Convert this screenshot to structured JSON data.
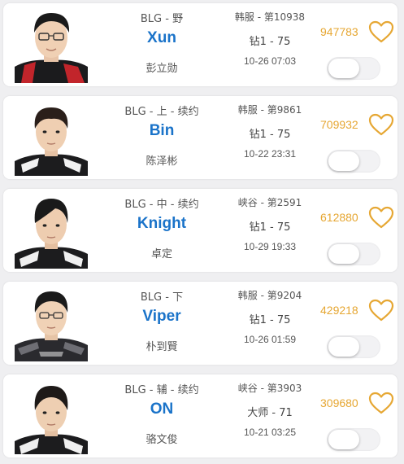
{
  "players": [
    {
      "team_line": "BLG - 野",
      "name": "Xun",
      "real_name": "彭立勋",
      "server": "韩服 - 第10938",
      "tier": "钻1 - 75",
      "time": "10-26 07:03",
      "score": "947783",
      "favorited": false,
      "toggle_on": false
    },
    {
      "team_line": "BLG - 上 - 续约",
      "name": "Bin",
      "real_name": "陈泽彬",
      "server": "韩服 - 第9861",
      "tier": "钻1 - 75",
      "time": "10-22 23:31",
      "score": "709932",
      "favorited": false,
      "toggle_on": false
    },
    {
      "team_line": "BLG - 中 - 续约",
      "name": "Knight",
      "real_name": "卓定",
      "server": "峡谷 - 第2591",
      "tier": "钻1 - 75",
      "time": "10-29 19:33",
      "score": "612880",
      "favorited": false,
      "toggle_on": false
    },
    {
      "team_line": "BLG - 下",
      "name": "Viper",
      "real_name": "朴到賢",
      "server": "韩服 - 第9204",
      "tier": "钻1 - 75",
      "time": "10-26 01:59",
      "score": "429218",
      "favorited": false,
      "toggle_on": false
    },
    {
      "team_line": "BLG - 辅 - 续约",
      "name": "ON",
      "real_name": "骆文俊",
      "server": "峡谷 - 第3903",
      "tier": "大师 - 71",
      "time": "10-21 03:25",
      "score": "309680",
      "favorited": false,
      "toggle_on": false
    }
  ],
  "colors": {
    "name": "#1a73c9",
    "score": "#e6a733",
    "heart": "#e6a733",
    "background": "#efeff1",
    "card": "#ffffff"
  },
  "icons": {
    "favorite": "heart-outline-icon",
    "avatar": "player-photo"
  }
}
